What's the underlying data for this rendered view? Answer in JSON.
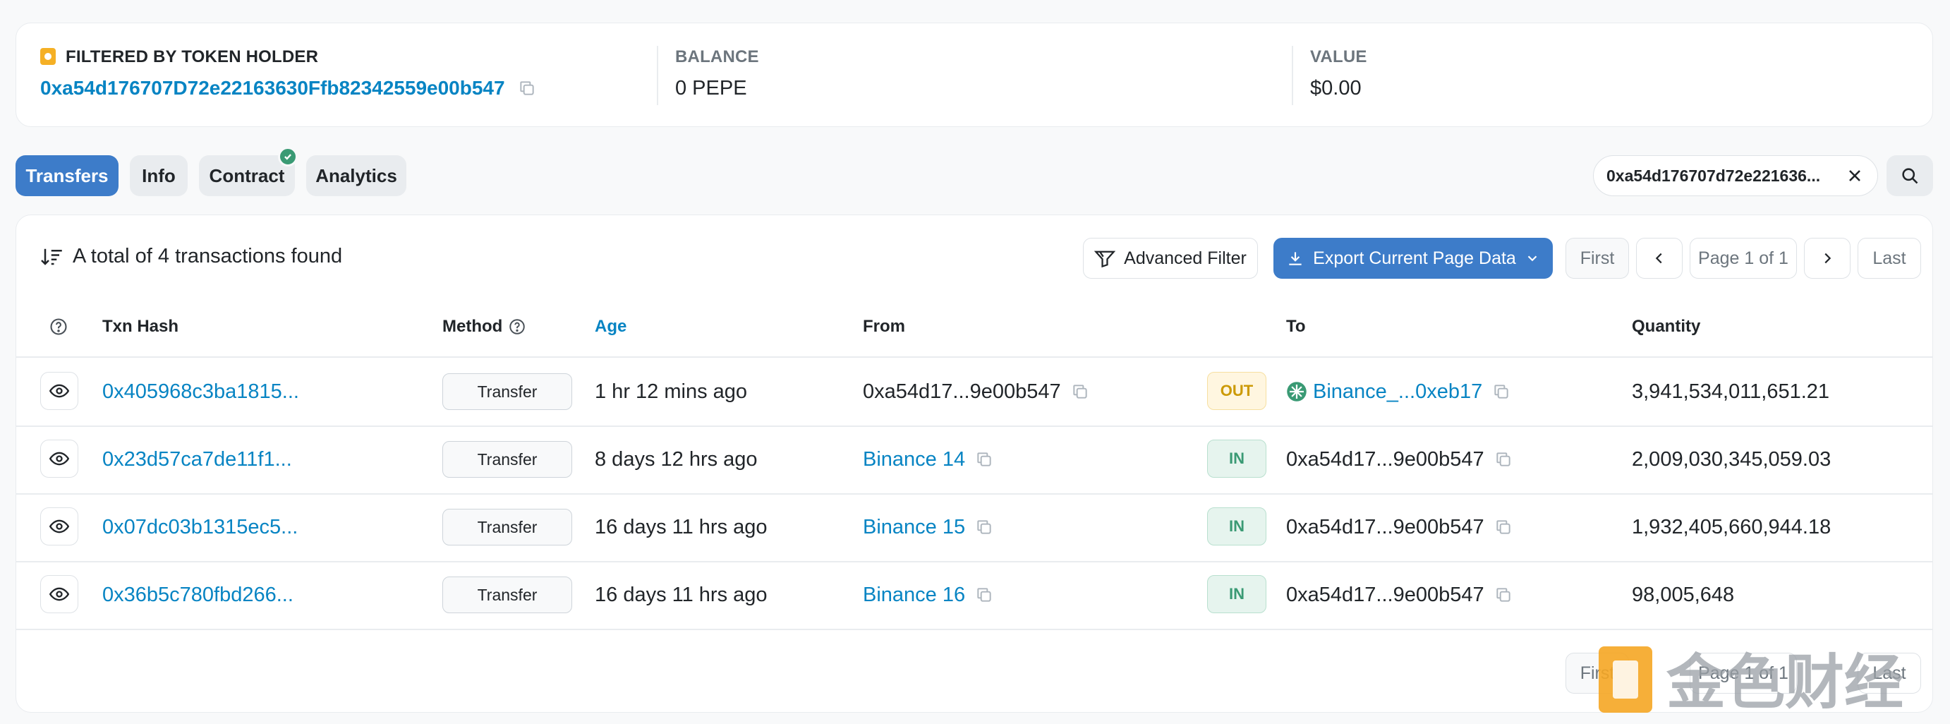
{
  "filter": {
    "label": "FILTERED BY TOKEN HOLDER",
    "address": "0xa54d176707D72e22163630Ffb82342559e00b547",
    "balance_label": "BALANCE",
    "balance_value": "0 PEPE",
    "value_label": "VALUE",
    "value_value": "$0.00"
  },
  "tabs": [
    {
      "label": "Transfers",
      "active": true
    },
    {
      "label": "Info"
    },
    {
      "label": "Contract",
      "verified": true
    },
    {
      "label": "Analytics"
    }
  ],
  "search": {
    "address_chip": "0xa54d176707d72e221636..."
  },
  "table": {
    "total_text": "A total of 4 transactions found",
    "advanced_filter": "Advanced Filter",
    "export": "Export Current Page Data",
    "pagination": {
      "first": "First",
      "page": "Page 1 of 1",
      "last": "Last"
    },
    "headers": {
      "txn_hash": "Txn Hash",
      "method": "Method",
      "age": "Age",
      "from": "From",
      "to": "To",
      "quantity": "Quantity"
    },
    "rows": [
      {
        "hash": "0x405968c3ba1815...",
        "method": "Transfer",
        "age": "1 hr 12 mins ago",
        "from": "0xa54d17...9e00b547",
        "dir": "OUT",
        "to": "Binance_...0xeb17",
        "quantity": "3,941,534,011,651.21"
      },
      {
        "hash": "0x23d57ca7de11f1...",
        "method": "Transfer",
        "age": "8 days 12 hrs ago",
        "from": "Binance 14",
        "dir": "IN",
        "to": "0xa54d17...9e00b547",
        "quantity": "2,009,030,345,059.03"
      },
      {
        "hash": "0x07dc03b1315ec5...",
        "method": "Transfer",
        "age": "16 days 11 hrs ago",
        "from": "Binance 15",
        "dir": "IN",
        "to": "0xa54d17...9e00b547",
        "quantity": "1,932,405,660,944.18"
      },
      {
        "hash": "0x36b5c780fbd266...",
        "method": "Transfer",
        "age": "16 days 11 hrs ago",
        "from": "Binance 16",
        "dir": "IN",
        "to": "0xa54d17...9e00b547",
        "quantity": "98,005,648"
      }
    ]
  },
  "bottom_pagination": {
    "first": "First",
    "page": "Page 1 of 1",
    "last": "Last"
  },
  "watermark": {
    "text": "金色财经"
  },
  "colors": {
    "link": "#0784c3",
    "primary": "#3d7cc9",
    "out": "#cc9a06",
    "in": "#3a9a74"
  }
}
